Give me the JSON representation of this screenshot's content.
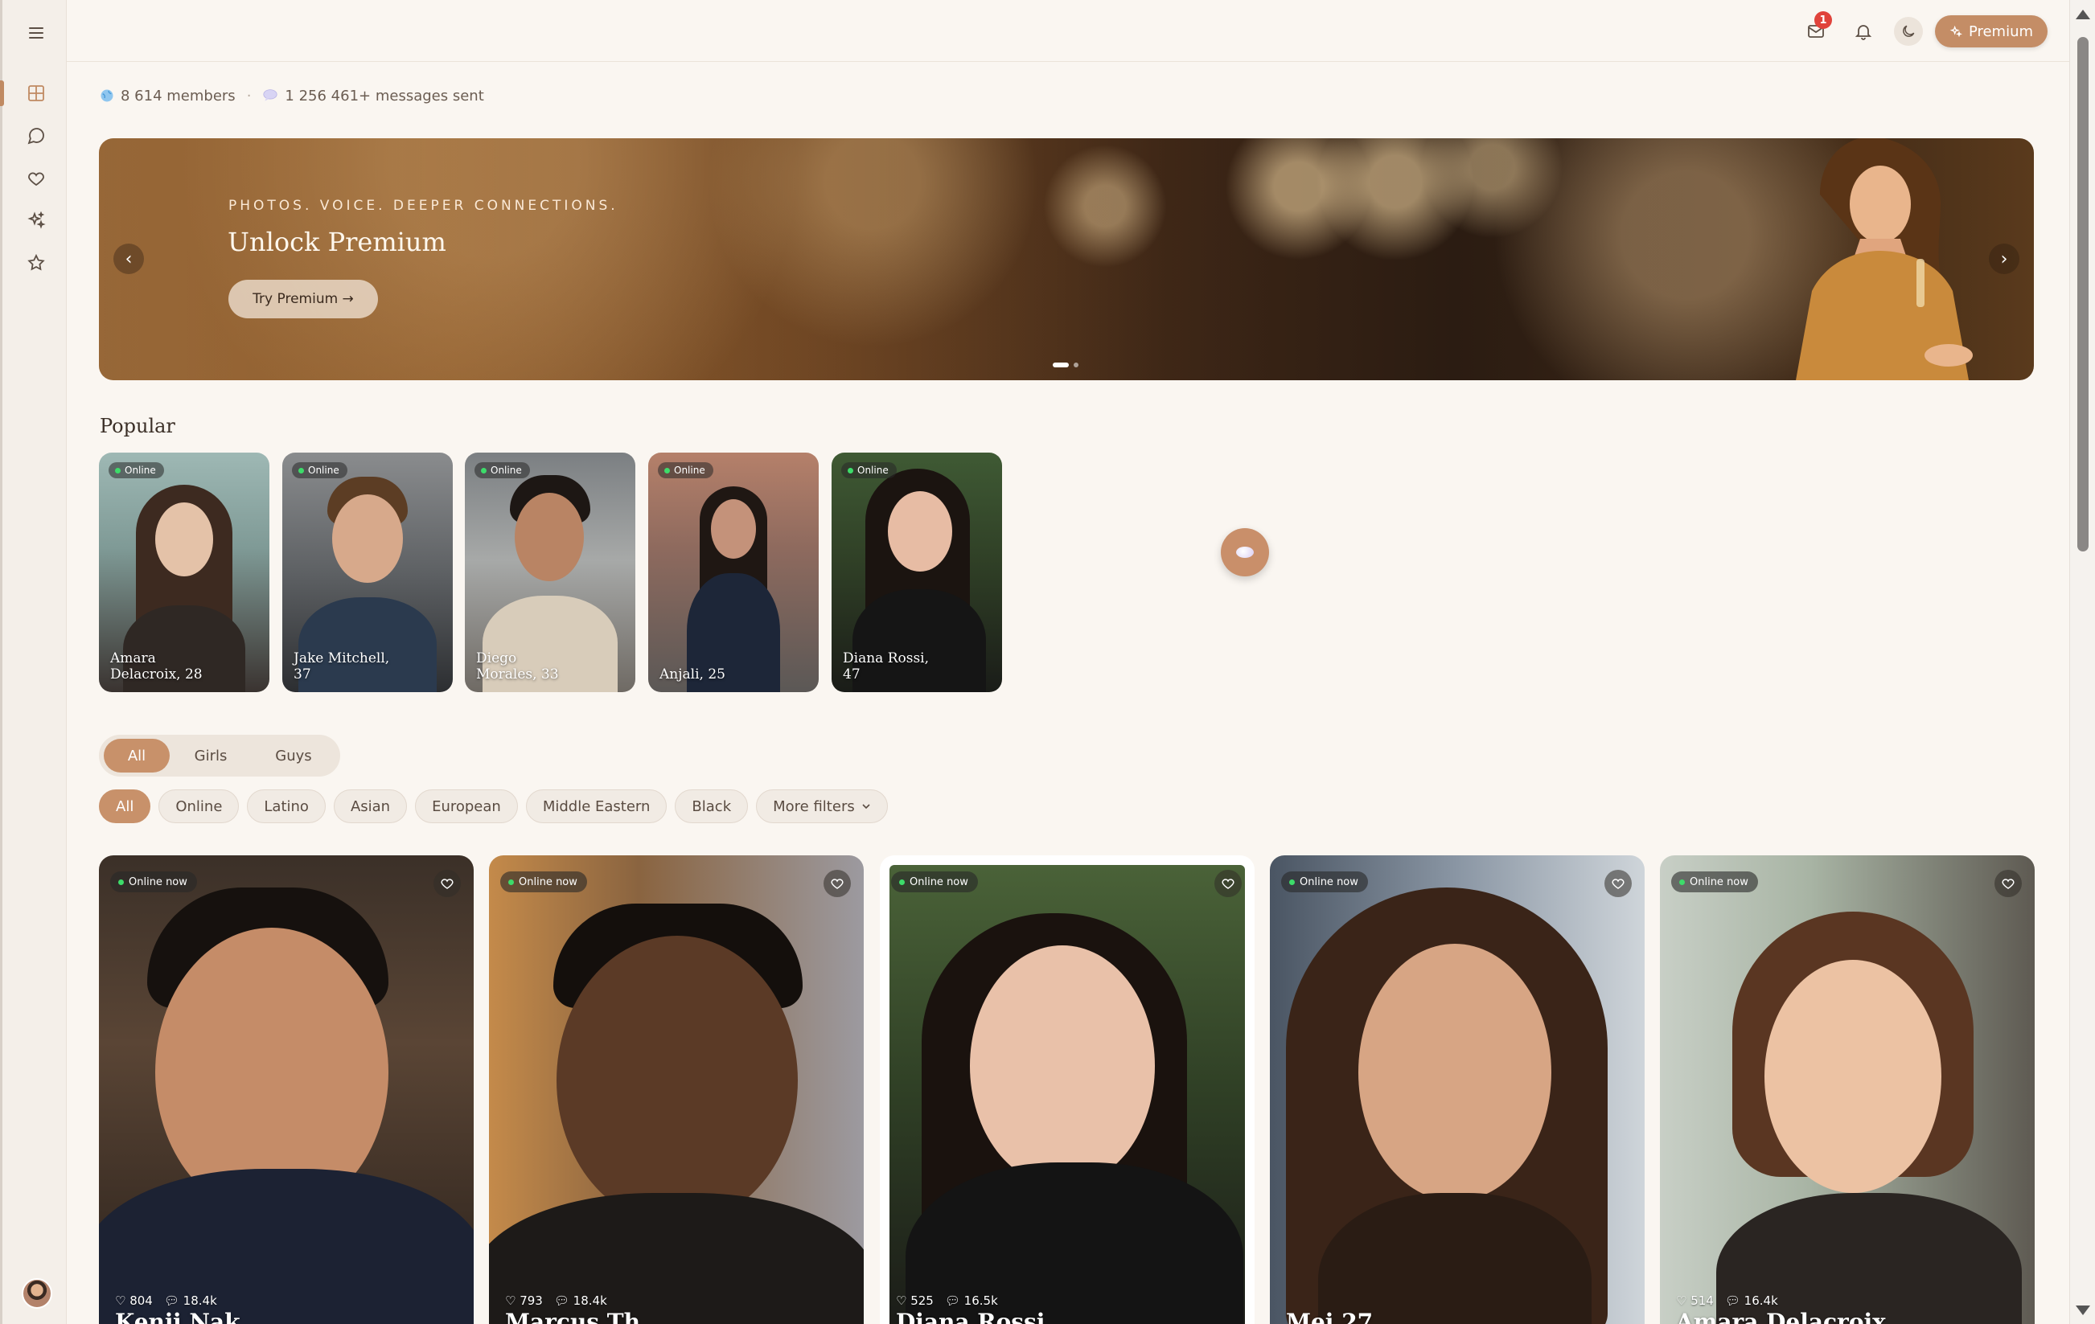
{
  "topbar": {
    "mail_badge": "1",
    "premium_label": "Premium"
  },
  "stats": {
    "members": "8 614 members",
    "separator": "·",
    "messages": "1 256 461+ messages sent"
  },
  "hero": {
    "kicker": "PHOTOS. VOICE. DEEPER CONNECTIONS.",
    "title": "Unlock Premium",
    "cta": "Try Premium →",
    "prev": "‹",
    "next": "›"
  },
  "popular": {
    "title": "Popular",
    "badge": "Online",
    "cards": [
      {
        "name": "Amara Delacroix, 28"
      },
      {
        "name": "Jake Mitchell, 37"
      },
      {
        "name": "Diego Morales, 33"
      },
      {
        "name": "Anjali, 25"
      },
      {
        "name": "Diana Rossi, 47"
      }
    ]
  },
  "segments": [
    "All",
    "Girls",
    "Guys"
  ],
  "filters": [
    "All",
    "Online",
    "Latino",
    "Asian",
    "European",
    "Middle Eastern",
    "Black",
    "More filters"
  ],
  "grid": {
    "badge": "Online now",
    "cards": [
      {
        "likes": "804",
        "messages": "18.4k",
        "name": "Kenji Nak"
      },
      {
        "likes": "793",
        "messages": "18.4k",
        "name": "Marcus Th"
      },
      {
        "likes": "525",
        "messages": "16.5k",
        "name": "Diana Rossi"
      },
      {
        "likes": "",
        "messages": "",
        "name": "Mei 27"
      },
      {
        "likes": "514",
        "messages": "16.4k",
        "name": "Amara Delacroix"
      }
    ]
  },
  "icons": {
    "menu": "menu-icon",
    "dashboard": "grid-icon",
    "chat": "chat-icon",
    "likes": "heart-icon",
    "discover": "sparkles-icon",
    "favorites": "star-icon",
    "mail": "mail-icon",
    "bell": "bell-icon",
    "theme": "moon-icon"
  },
  "colors": {
    "accent": "#c48d66",
    "background": "#faf6f1",
    "online": "#3ddc6a",
    "badge": "#e0433b"
  }
}
